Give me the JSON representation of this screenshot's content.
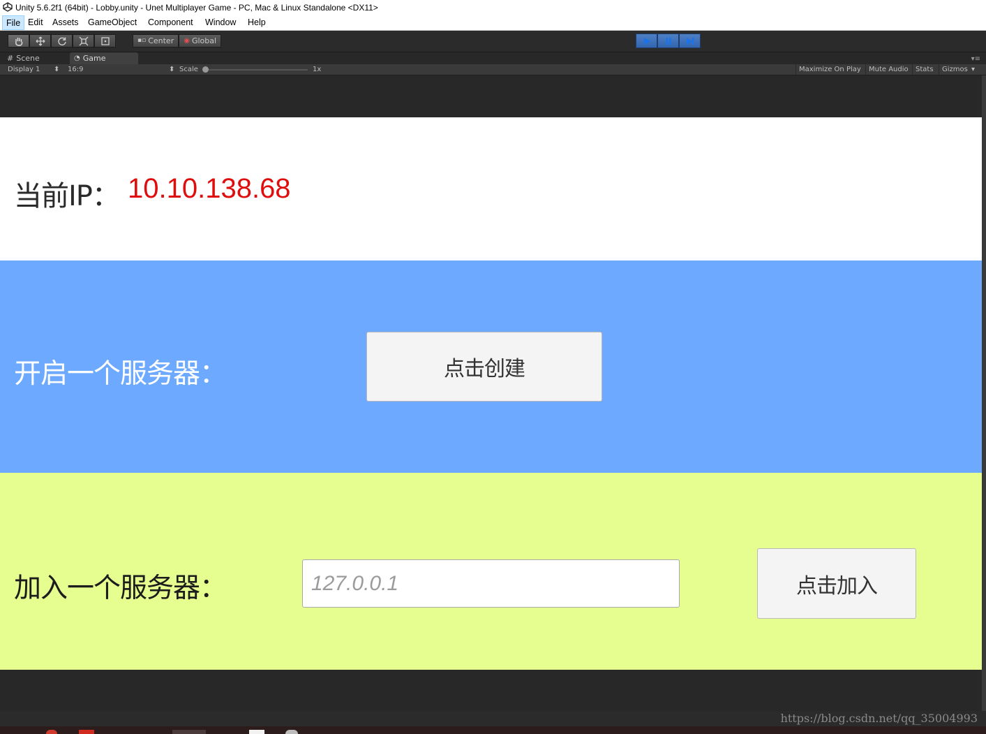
{
  "window": {
    "title": "Unity 5.6.2f1 (64bit) - Lobby.unity - Unet Multiplayer Game - PC, Mac & Linux Standalone <DX11>"
  },
  "menu": {
    "items": [
      "File",
      "Edit",
      "Assets",
      "GameObject",
      "Component",
      "Window",
      "Help"
    ],
    "active": "File"
  },
  "toolbar": {
    "tools": [
      "hand-icon",
      "move-icon",
      "rotate-icon",
      "scale-icon",
      "rect-icon"
    ],
    "pivot_label": "Center",
    "space_label": "Global",
    "accent_color": "#3a6fb8"
  },
  "tabs": {
    "scene_label": "Scene",
    "game_label": "Game"
  },
  "game_controls": {
    "display": "Display 1",
    "aspect": "16:9",
    "scale_label": "Scale",
    "scale_value": "1x",
    "maximize_on_play": "Maximize On Play",
    "mute_audio": "Mute Audio",
    "stats": "Stats",
    "gizmos": "Gizmos"
  },
  "game": {
    "ip_label": "当前IP：",
    "ip_value": "10.10.138.68",
    "ip_value_color": "#e00d0d",
    "create_label": "开启一个服务器：",
    "create_button": "点击创建",
    "join_label": "加入一个服务器：",
    "join_placeholder": "127.0.0.1",
    "join_button": "点击加入",
    "colors": {
      "ip_panel": "#ffffff",
      "create_panel": "#6ca9ff",
      "join_panel": "#e6fd90"
    }
  },
  "watermark": "https://blog.csdn.net/qq_35004993"
}
